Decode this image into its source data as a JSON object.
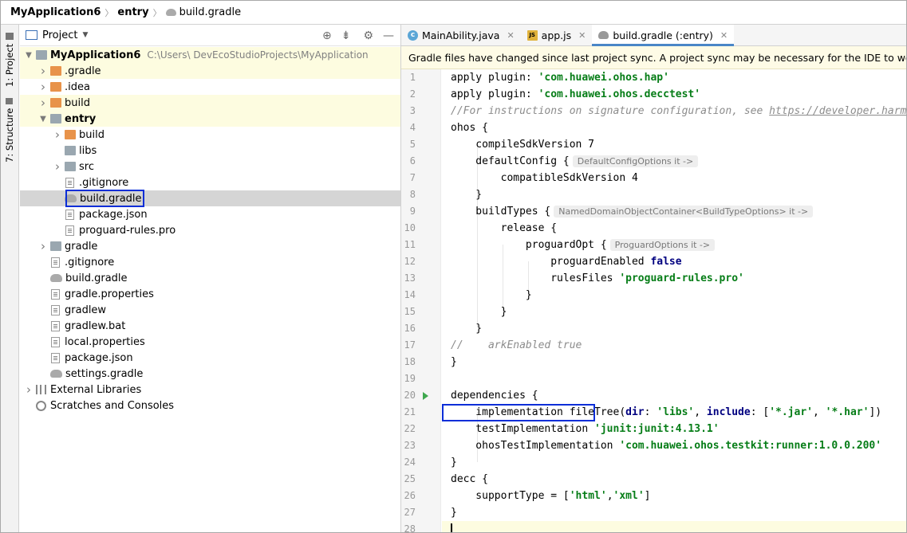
{
  "breadcrumb": [
    "MyApplication6",
    "entry",
    "build.gradle"
  ],
  "sidebar": {
    "project_label": "1: Project",
    "structure_label": "7: Structure"
  },
  "project_panel": {
    "title": "Project",
    "tree": [
      {
        "label": "MyApplication6",
        "path": "C:\\Users\\          DevEcoStudioProjects\\MyApplication",
        "depth": 0,
        "arrow": "down",
        "icon": "module-folder-icon",
        "bold": true
      },
      {
        "label": ".gradle",
        "depth": 1,
        "arrow": "right",
        "icon": "folder-orange-icon"
      },
      {
        "label": ".idea",
        "depth": 1,
        "arrow": "right",
        "icon": "folder-orange-icon"
      },
      {
        "label": "build",
        "depth": 1,
        "arrow": "right",
        "icon": "folder-orange-icon"
      },
      {
        "label": "entry",
        "depth": 1,
        "arrow": "down",
        "icon": "module-folder-icon",
        "bold": true
      },
      {
        "label": "build",
        "depth": 2,
        "arrow": "right",
        "icon": "folder-orange-icon"
      },
      {
        "label": "libs",
        "depth": 2,
        "arrow": "",
        "icon": "folder-icon"
      },
      {
        "label": "src",
        "depth": 2,
        "arrow": "right",
        "icon": "folder-icon"
      },
      {
        "label": ".gitignore",
        "depth": 2,
        "arrow": "",
        "icon": "file-icon"
      },
      {
        "label": "build.gradle",
        "depth": 2,
        "arrow": "",
        "icon": "gradle-icon"
      },
      {
        "label": "package.json",
        "depth": 2,
        "arrow": "",
        "icon": "file-icon"
      },
      {
        "label": "proguard-rules.pro",
        "depth": 2,
        "arrow": "",
        "icon": "file-icon"
      },
      {
        "label": "gradle",
        "depth": 1,
        "arrow": "right",
        "icon": "folder-icon"
      },
      {
        "label": ".gitignore",
        "depth": 1,
        "arrow": "",
        "icon": "file-icon"
      },
      {
        "label": "build.gradle",
        "depth": 1,
        "arrow": "",
        "icon": "gradle-icon"
      },
      {
        "label": "gradle.properties",
        "depth": 1,
        "arrow": "",
        "icon": "file-icon"
      },
      {
        "label": "gradlew",
        "depth": 1,
        "arrow": "",
        "icon": "file-icon"
      },
      {
        "label": "gradlew.bat",
        "depth": 1,
        "arrow": "",
        "icon": "file-icon"
      },
      {
        "label": "local.properties",
        "depth": 1,
        "arrow": "",
        "icon": "file-icon"
      },
      {
        "label": "package.json",
        "depth": 1,
        "arrow": "",
        "icon": "file-icon"
      },
      {
        "label": "settings.gradle",
        "depth": 1,
        "arrow": "",
        "icon": "gradle-icon"
      },
      {
        "label": "External Libraries",
        "depth": 0,
        "arrow": "right",
        "icon": "library-icon"
      },
      {
        "label": "Scratches and Consoles",
        "depth": 0,
        "arrow": "",
        "icon": "scratches-icon"
      }
    ]
  },
  "editor": {
    "tabs": [
      {
        "label": "MainAbility.java",
        "icon": "java-class-icon",
        "active": false
      },
      {
        "label": "app.js",
        "icon": "js-file-icon",
        "active": false
      },
      {
        "label": "build.gradle (:entry)",
        "icon": "gradle-icon",
        "active": true
      }
    ],
    "banner": "Gradle files have changed since last project sync. A project sync may be necessary for the IDE to work properly.",
    "line_numbers": [
      "1",
      "2",
      "3",
      "4",
      "5",
      "6",
      "7",
      "8",
      "9",
      "10",
      "11",
      "12",
      "13",
      "14",
      "15",
      "16",
      "17",
      "18",
      "19",
      "20",
      "21",
      "22",
      "23",
      "24",
      "25",
      "26",
      "27",
      "28"
    ],
    "hints": {
      "defaultConfig": "DefaultConfigOptions it ->",
      "buildTypes": "NamedDomainObjectContainer<BuildTypeOptions> it ->",
      "proguardOpt": "ProguardOptions it ->"
    },
    "code": {
      "l1_kw": "apply plugin: ",
      "l1_str": "'com.huawei.ohos.hap'",
      "l2_kw": "apply plugin: ",
      "l2_str": "'com.huawei.ohos.decctest'",
      "l3_cm": "//For instructions on signature configuration, see ",
      "l3_link": "https://developer.harmonyos.com",
      "l4": "ohos {",
      "l5": "    compileSdkVersion 7",
      "l6": "    defaultConfig {",
      "l7": "        compatibleSdkVersion 4",
      "l8": "    }",
      "l9": "    buildTypes {",
      "l10": "        release {",
      "l11": "            proguardOpt {",
      "l12_a": "                proguardEnabled ",
      "l12_kw": "false",
      "l13_a": "                rulesFiles ",
      "l13_str": "'proguard-rules.pro'",
      "l14": "            }",
      "l15": "        }",
      "l16": "    }",
      "l17": "//    arkEnabled true",
      "l18": "}",
      "l19": "",
      "l20": "dependencies {",
      "l21_a": "    implementation fileTree(",
      "l21_k1": "dir",
      "l21_b": ": ",
      "l21_s1": "'libs'",
      "l21_c": ", ",
      "l21_k2": "include",
      "l21_d": ": [",
      "l21_s2": "'*.jar'",
      "l21_e": ", ",
      "l21_s3": "'*.har'",
      "l21_f": "])",
      "l22_a": "    testImplementation ",
      "l22_str": "'junit:junit:4.13.1'",
      "l23_a": "    ohosTestImplementation ",
      "l23_str": "'com.huawei.ohos.testkit:runner:1.0.0.200'",
      "l24": "}",
      "l25": "decc {",
      "l26_a": "    supportType = [",
      "l26_s1": "'html'",
      "l26_b": ",",
      "l26_s2": "'xml'",
      "l26_c": "]",
      "l27": "}",
      "l28": ""
    }
  }
}
